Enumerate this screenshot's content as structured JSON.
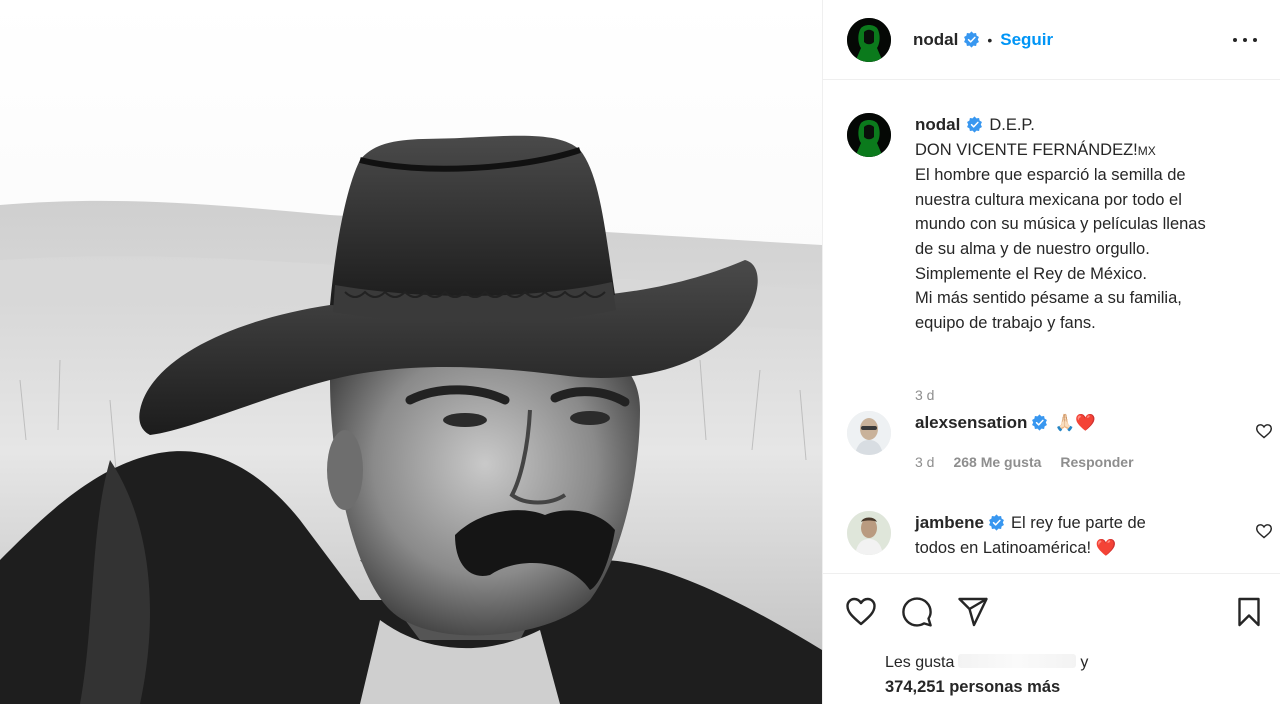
{
  "post": {
    "image_icon": "cowboy-portrait-photo",
    "image_style": "black-and-white"
  },
  "header": {
    "username": "nodal",
    "separator": "•",
    "follow_label": "Seguir",
    "more_icon": "more-horizontal-icon"
  },
  "caption": {
    "username": "nodal",
    "lines": [
      "D.E.P.",
      "DON VICENTE FERNÁNDEZ!",
      "El hombre que esparció la semilla de",
      "nuestra cultura mexicana por todo el",
      "mundo con su música y películas llenas",
      "de su alma y de nuestro orgullo.",
      "Simplemente el Rey de México.",
      "Mi más sentido pésame a su familia,",
      "equipo de trabajo y fans."
    ],
    "flag_text": "MX",
    "time": "3 d"
  },
  "comments": [
    {
      "username": "alexsensation",
      "text": "🙏🏻",
      "heart": "❤️",
      "time": "3 d",
      "likes": "268 Me gusta",
      "reply_label": "Responder"
    },
    {
      "username": "jambene",
      "text_line1": "El rey fue parte de",
      "text_line2": "todos en Latinoamérica!",
      "heart": "❤️"
    }
  ],
  "actions": {
    "like_icon": "heart-outline-icon",
    "comment_icon": "comment-bubble-icon",
    "share_icon": "paper-plane-icon",
    "save_icon": "bookmark-icon"
  },
  "likes": {
    "prefix": "Les gusta",
    "connector": "y",
    "count_text": "374,251 personas más"
  },
  "colors": {
    "accent": "#0095f6",
    "verified": "#3897f0",
    "heart": "#e2112c",
    "muted": "#8e8e8e",
    "avatar_green": "#0b7a1c"
  }
}
